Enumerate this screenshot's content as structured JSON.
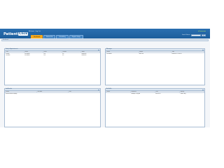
{
  "header": {
    "logo_main": "Patient",
    "logo_accent": "Click",
    "user_line": "Welcome  |  Log Out",
    "brand": "eCarecom",
    "search_label": "Search Patient:",
    "search_button": "Go"
  },
  "tabs": [
    "Dashboard",
    "Patient File",
    "Scheduling",
    "Reports Setup"
  ],
  "breadcrumb": "Dashboard",
  "visits": {
    "title": "Today's Appointments",
    "columns": [
      "Time",
      "Patient",
      "Phone",
      "Provider",
      "Status"
    ],
    "rows": [
      {
        "time": "9:00 AM",
        "patient": "Test Patient",
        "phone": "1-16",
        "provider": "0:0",
        "status": "Checked In"
      },
      {
        "time": "10:00 AM",
        "patient": "Test Patient",
        "phone": "1-16",
        "provider": "0:0",
        "status": "Checked In"
      }
    ]
  },
  "messages": {
    "title": "Messages",
    "columns": [
      "Patient",
      "Subject",
      "Date"
    ],
    "rows": [
      {
        "patient": "Test Patient",
        "subject": "Refill Test",
        "date": "03/04/2011 12:00 PM"
      }
    ]
  },
  "labs": {
    "title": "Lab Results",
    "columns": [
      "Patient",
      "Lab Name",
      "Date"
    ],
    "empty": "No lab results for display"
  },
  "rx": {
    "title": "Rx Refills",
    "columns": [
      "Patient",
      "Medication",
      "Date",
      "Quantity"
    ],
    "rows": [
      {
        "patient": "",
        "medication": "Lisinopril 10 mg tab",
        "date": "03/03/2011",
        "quantity": "1 TAB 1 daily"
      }
    ]
  },
  "colors": {
    "header_blue": "#1d5e9c",
    "tab_active": "#f4a81d",
    "brand_green": "#9bd36a"
  }
}
